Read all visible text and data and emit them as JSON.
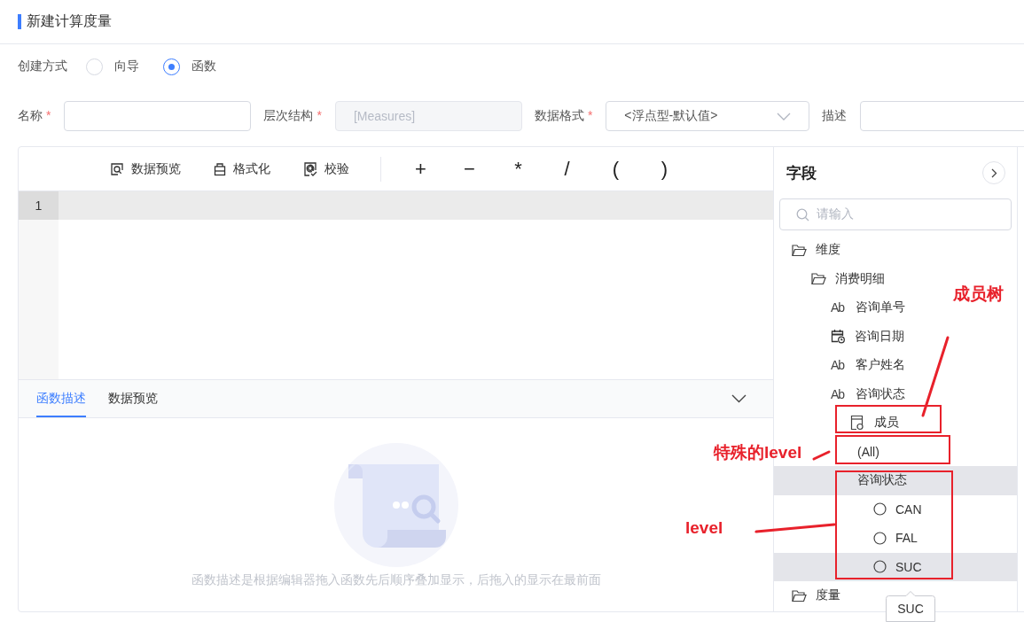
{
  "title": "新建计算度量",
  "create_mode": {
    "label": "创建方式",
    "options": [
      {
        "label": "向导",
        "selected": false
      },
      {
        "label": "函数",
        "selected": true
      }
    ]
  },
  "form": {
    "fields": [
      {
        "kind": "input",
        "label": "名称",
        "required": true
      },
      {
        "kind": "disabled",
        "label": "层次结构",
        "required": true,
        "value": "[Measures]"
      },
      {
        "kind": "select",
        "label": "数据格式",
        "required": true,
        "value": "<浮点型-默认值>"
      },
      {
        "kind": "input",
        "label": "描述",
        "required": false
      }
    ]
  },
  "editor": {
    "toolbar": [
      {
        "kind": "preview",
        "label": "数据预览"
      },
      {
        "kind": "format",
        "label": "格式化"
      },
      {
        "kind": "validate",
        "label": "校验"
      }
    ],
    "operators": [
      "+",
      "−",
      "*",
      "/",
      "(",
      ")"
    ],
    "line_numbers": [
      "1"
    ],
    "bottom_tabs": [
      {
        "label": "函数描述",
        "selected": true
      },
      {
        "label": "数据预览",
        "selected": false
      }
    ],
    "empty_text": "函数描述是根据编辑器拖入函数先后顺序叠加显示，后拖入的显示在最前面"
  },
  "fields_panel": {
    "title": "字段",
    "search_placeholder": "请输入",
    "tooltip": "SUC",
    "tree": [
      {
        "label": "维度",
        "kind": "folder",
        "highlighted": false,
        "children": [
          {
            "label": "消费明细",
            "kind": "folder",
            "highlighted": false,
            "children": [
              {
                "label": "咨询单号",
                "kind": "text",
                "icon": "Ab",
                "highlighted": false
              },
              {
                "label": "咨询日期",
                "kind": "date",
                "highlighted": false
              },
              {
                "label": "客户姓名",
                "kind": "text",
                "icon": "Ab",
                "highlighted": false
              },
              {
                "label": "咨询状态",
                "kind": "text",
                "icon": "Ab",
                "highlighted": false,
                "children": [
                  {
                    "label": "成员",
                    "kind": "member-tree",
                    "highlighted": false,
                    "children": [
                      {
                        "label": "(All)",
                        "kind": "level",
                        "highlighted": false
                      },
                      {
                        "label": "咨询状态",
                        "kind": "level",
                        "highlighted": true,
                        "children": [
                          {
                            "label": "CAN",
                            "kind": "member",
                            "highlighted": false
                          },
                          {
                            "label": "FAL",
                            "kind": "member",
                            "highlighted": false
                          },
                          {
                            "label": "SUC",
                            "kind": "member",
                            "highlighted": true
                          }
                        ]
                      }
                    ]
                  }
                ]
              }
            ]
          }
        ]
      },
      {
        "label": "度量",
        "kind": "folder",
        "highlighted": false
      }
    ]
  },
  "annotations": [
    {
      "text": "成员树"
    },
    {
      "text": "特殊的level"
    },
    {
      "text": "level"
    }
  ]
}
